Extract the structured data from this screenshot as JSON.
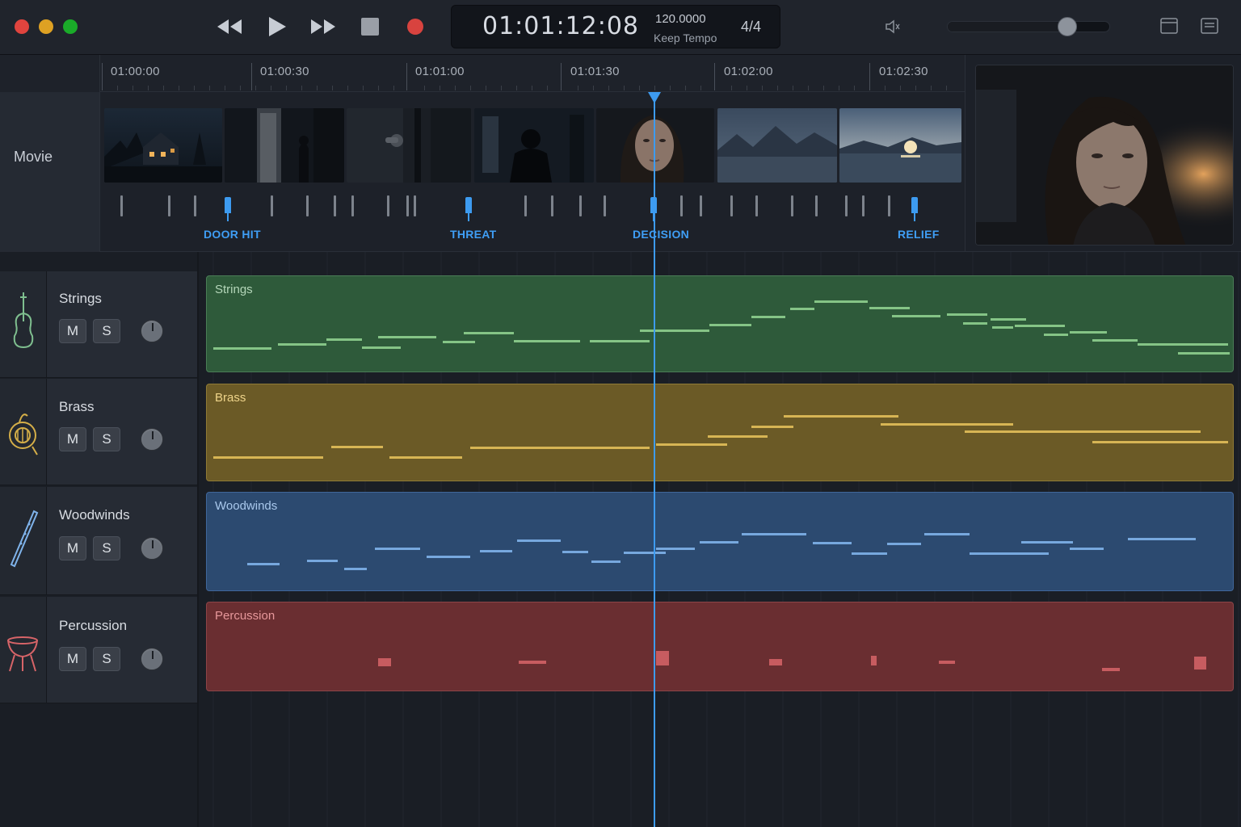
{
  "window": {
    "traffic_lights": [
      "close",
      "minimize",
      "maximize"
    ]
  },
  "transport": {
    "buttons": [
      "rewind-icon",
      "play-icon",
      "fast-forward-icon",
      "stop-icon",
      "record-icon"
    ],
    "record_color": "#d8433f"
  },
  "lcd": {
    "time": "01:01:12:08",
    "tempo": "120.0000",
    "tempo_mode": "Keep Tempo",
    "signature": "4/4"
  },
  "master_volume": {
    "level": 0.74
  },
  "ruler": {
    "labels": [
      "01:00:00",
      "01:00:30",
      "01:01:00",
      "01:01:30",
      "01:02:00",
      "01:02:30"
    ]
  },
  "movie": {
    "label": "Movie",
    "thumbnails": [
      "house-at-night",
      "doorway-figure",
      "door-handle",
      "man-in-hallway",
      "woman-face",
      "mountain-lake-dusk",
      "sunset-over-lake"
    ],
    "markers": [
      {
        "label": "DOOR HIT"
      },
      {
        "label": "THREAT"
      },
      {
        "label": "DECISION"
      },
      {
        "label": "RELIEF"
      }
    ]
  },
  "viewer": {
    "frame": "woman-portrait"
  },
  "tracks": [
    {
      "name": "Strings",
      "region_label": "Strings",
      "icon": "violin-icon",
      "color": "#2e5a3a",
      "note_color": "#8fcf8f",
      "mute": "M",
      "solo": "S"
    },
    {
      "name": "Brass",
      "region_label": "Brass",
      "icon": "french-horn-icon",
      "color": "#6b5a26",
      "note_color": "#e3bf5a",
      "mute": "M",
      "solo": "S"
    },
    {
      "name": "Woodwinds",
      "region_label": "Woodwinds",
      "icon": "flute-icon",
      "color": "#2c4a70",
      "note_color": "#7fb3ea",
      "mute": "M",
      "solo": "S"
    },
    {
      "name": "Percussion",
      "region_label": "Percussion",
      "icon": "timpani-icon",
      "color": "#6a2e31",
      "note_color": "#d76468",
      "mute": "M",
      "solo": "S"
    }
  ],
  "playhead_color": "#3d9bf0"
}
